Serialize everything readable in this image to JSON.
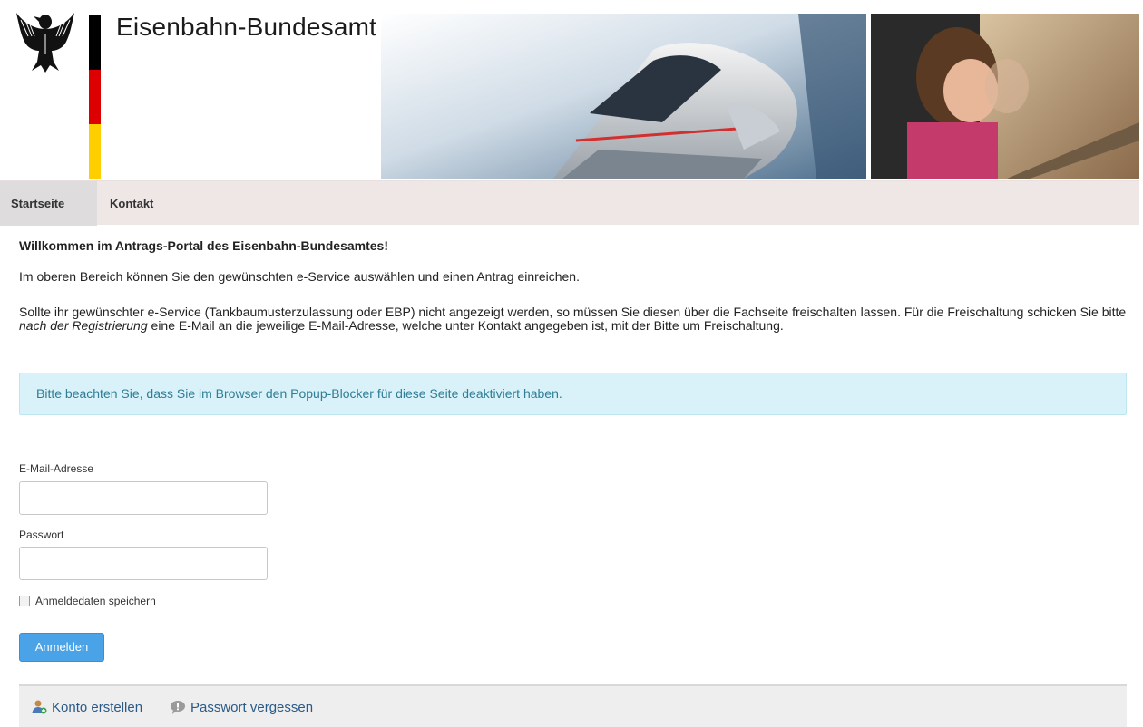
{
  "header": {
    "title": "Eisenbahn-Bundesamt",
    "flag_colors": [
      "#000000",
      "#dd0000",
      "#ffce00"
    ]
  },
  "nav": {
    "items": [
      {
        "label": "Startseite",
        "active": true
      },
      {
        "label": "Kontakt",
        "active": false
      }
    ]
  },
  "main": {
    "welcome": "Willkommen im Antrags-Portal des Eisenbahn-Bundesamtes!",
    "intro": "Im oberen Bereich können Sie den gewünschten e-Service auswählen und einen Antrag einreichen.",
    "info_part1": "Sollte ihr gewünschter e-Service (Tankbaumusterzulassung oder EBP) nicht angezeigt werden, so müssen Sie diesen über die Fachseite freischalten lassen. Für die Freischaltung schicken Sie bitte ",
    "info_italic": "nach der Registrierung",
    "info_part2": " eine E-Mail an die jeweilige E-Mail-Adresse, welche unter Kontakt angegeben ist, mit der Bitte um Freischaltung.",
    "alert": "Bitte beachten Sie, dass Sie im Browser den Popup-Blocker für diese Seite deaktiviert haben."
  },
  "login": {
    "email_label": "E-Mail-Adresse",
    "email_value": "",
    "password_label": "Passwort",
    "password_value": "",
    "remember_label": "Anmeldedaten speichern",
    "remember_checked": false,
    "submit_label": "Anmelden"
  },
  "footer": {
    "create_account": "Konto erstellen",
    "forgot_password": "Passwort vergessen"
  },
  "colors": {
    "accent_button": "#4aa3e6",
    "alert_bg": "#d9f1f8",
    "alert_text": "#2f7d96",
    "nav_bg": "#efe6e6",
    "link": "#2a5a87"
  }
}
